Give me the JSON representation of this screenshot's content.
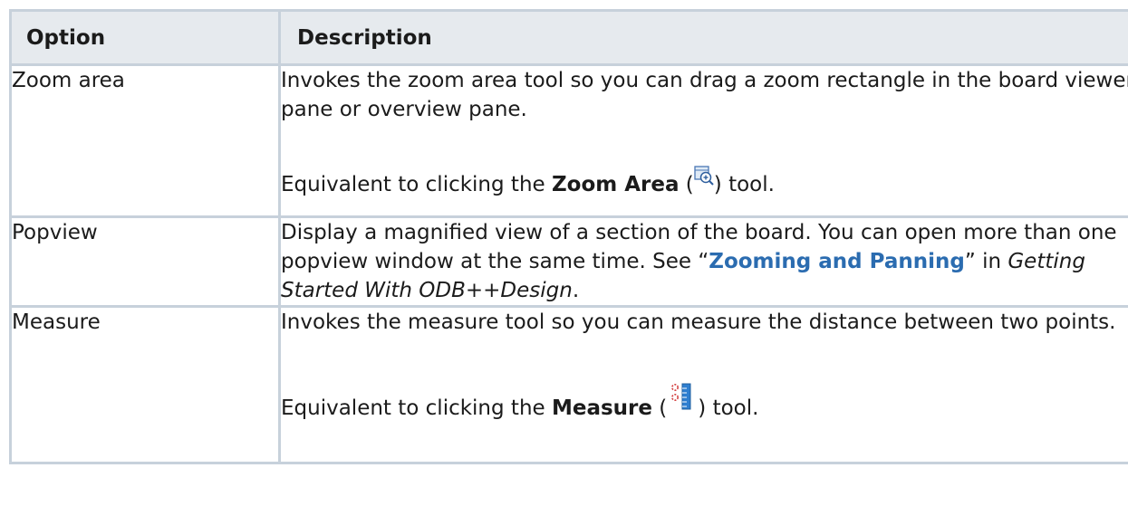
{
  "header": {
    "option": "Option",
    "description": "Description"
  },
  "rows": [
    {
      "option": "Zoom area",
      "desc": "Invokes the zoom area tool so you can drag a zoom rectangle in the board viewer pane or overview pane.",
      "eq_pre": "Equivalent to clicking the ",
      "eq_bold": "Zoom Area",
      "eq_open": " (",
      "eq_close": ") tool.",
      "icon": "zoom-area-icon"
    },
    {
      "option": "Popview",
      "desc_pre": "Display a magnified view of a section of the board. You can open more than one popview window at the same time. See “",
      "link": "Zooming and Panning",
      "desc_mid": "” in ",
      "desc_italic": "Getting Started With ODB++Design",
      "desc_post": "."
    },
    {
      "option": "Measure",
      "desc": "Invokes the measure tool so you can measure the distance between two points.",
      "eq_pre": "Equivalent to clicking the ",
      "eq_bold": "Measure",
      "eq_open": " (",
      "eq_close": ") tool.",
      "icon": "measure-icon"
    }
  ],
  "colors": {
    "header_bg": "#e6eaee",
    "border": "#c7d1db",
    "link": "#2b6cb0"
  }
}
